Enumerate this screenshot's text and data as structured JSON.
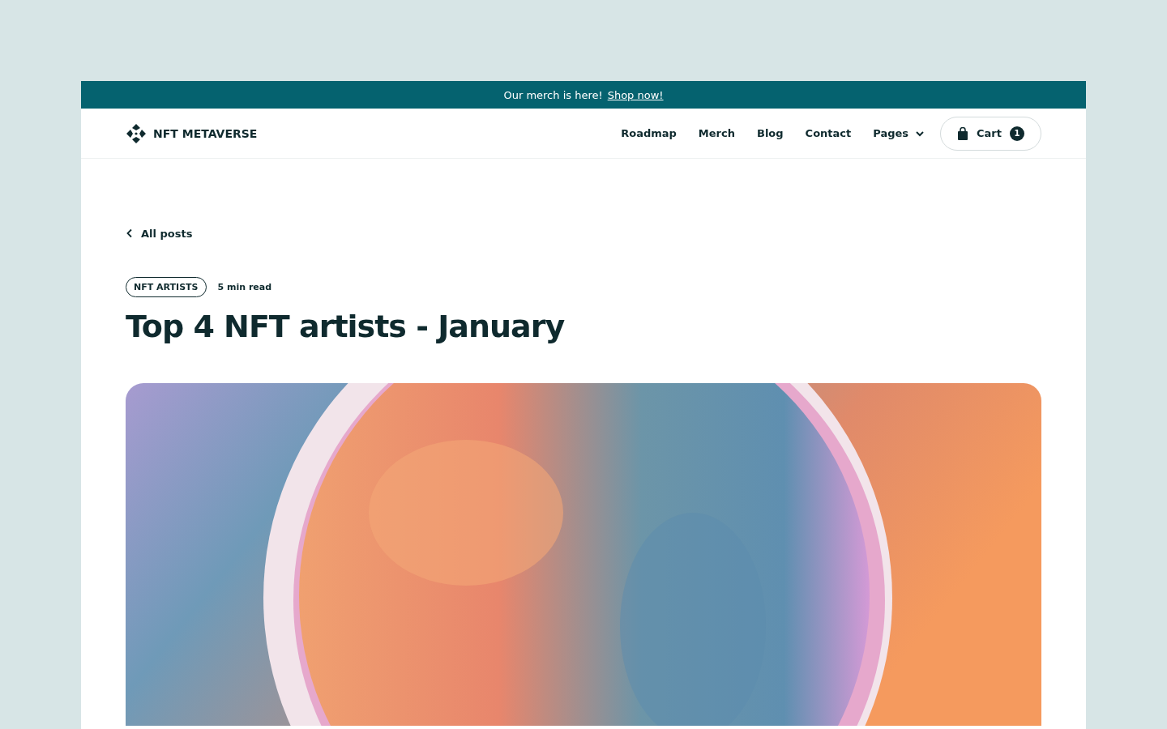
{
  "announcement": {
    "text": "Our merch is here!",
    "link": "Shop now!"
  },
  "header": {
    "logo": "NFT METAVERSE",
    "nav": [
      {
        "label": "Roadmap",
        "kind": "link"
      },
      {
        "label": "Merch",
        "kind": "link"
      },
      {
        "label": "Blog",
        "kind": "link"
      },
      {
        "label": "Contact",
        "kind": "link"
      },
      {
        "label": "Pages",
        "kind": "dropdown"
      }
    ],
    "cart": {
      "label": "Cart",
      "count": "1"
    }
  },
  "post": {
    "back_link": "All posts",
    "tag": "NFT ARTISTS",
    "read_time": "5 min read",
    "title": "Top 4 NFT artists - January"
  }
}
